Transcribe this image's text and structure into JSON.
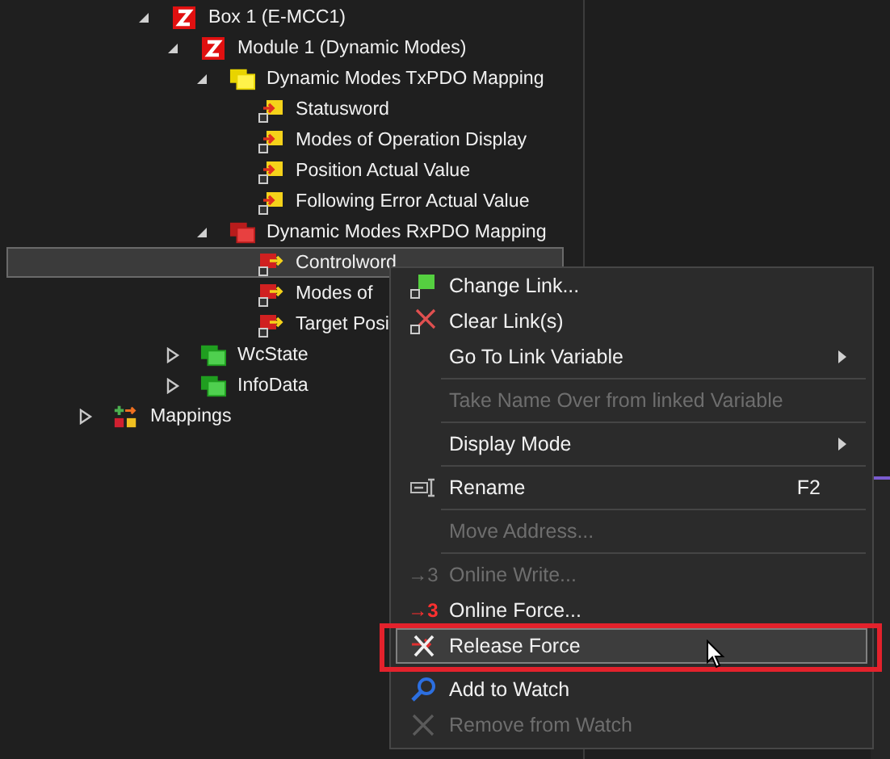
{
  "tree": [
    {
      "label": "Box 1 (E-MCC1)",
      "kind": "device",
      "expanded": true,
      "selected": false,
      "children": [
        {
          "label": "Module 1 (Dynamic Modes)",
          "kind": "device",
          "expanded": true,
          "selected": false,
          "children": [
            {
              "label": "Dynamic Modes TxPDO Mapping",
              "kind": "input_group",
              "expanded": true,
              "selected": false,
              "children": [
                {
                  "label": "Statusword",
                  "kind": "input_var",
                  "selected": false
                },
                {
                  "label": "Modes of Operation Display",
                  "kind": "input_var",
                  "selected": false
                },
                {
                  "label": "Position Actual Value",
                  "kind": "input_var",
                  "selected": false
                },
                {
                  "label": "Following Error Actual Value",
                  "kind": "input_var",
                  "selected": false
                }
              ]
            },
            {
              "label": "Dynamic Modes RxPDO Mapping",
              "kind": "output_group",
              "expanded": true,
              "selected": false,
              "children": [
                {
                  "label": "Controlword",
                  "kind": "output_var",
                  "selected": true
                },
                {
                  "label": "Modes of",
                  "kind": "output_var",
                  "selected": false
                },
                {
                  "label": "Target Posi",
                  "kind": "output_var",
                  "selected": false
                }
              ]
            }
          ]
        },
        {
          "label": "WcState",
          "kind": "status_group",
          "expanded": false,
          "selected": false
        },
        {
          "label": "InfoData",
          "kind": "status_group",
          "expanded": false,
          "selected": false
        }
      ]
    },
    {
      "label": "Mappings",
      "kind": "mappings",
      "expanded": false,
      "selected": false
    }
  ],
  "context_menu": [
    {
      "kind": "item",
      "label": "Change Link...",
      "disabled": false,
      "submenu": false,
      "selected": false
    },
    {
      "kind": "item",
      "label": "Clear Link(s)",
      "disabled": false,
      "submenu": false,
      "selected": false
    },
    {
      "kind": "item",
      "label": "Go To Link Variable",
      "disabled": false,
      "submenu": true,
      "selected": false
    },
    {
      "kind": "separator"
    },
    {
      "kind": "item",
      "label": "Take Name Over from linked Variable",
      "disabled": true,
      "submenu": false,
      "selected": false
    },
    {
      "kind": "separator"
    },
    {
      "kind": "item",
      "label": "Display Mode",
      "disabled": false,
      "submenu": true,
      "selected": false
    },
    {
      "kind": "separator"
    },
    {
      "kind": "item",
      "label": "Rename",
      "shortcut": "F2",
      "disabled": false,
      "submenu": false,
      "selected": false
    },
    {
      "kind": "separator"
    },
    {
      "kind": "item",
      "label": "Move Address...",
      "disabled": true,
      "submenu": false,
      "selected": false
    },
    {
      "kind": "separator"
    },
    {
      "kind": "item",
      "label": "Online Write...",
      "icon_text": "→3",
      "disabled": true,
      "submenu": false,
      "selected": false
    },
    {
      "kind": "item",
      "label": "Online Force...",
      "icon_text": "→3",
      "disabled": false,
      "submenu": false,
      "selected": false
    },
    {
      "kind": "item",
      "label": "Release Force",
      "disabled": false,
      "submenu": false,
      "selected": true
    },
    {
      "kind": "separator"
    },
    {
      "kind": "item",
      "label": "Add to Watch",
      "disabled": false,
      "submenu": false,
      "selected": false
    },
    {
      "kind": "item",
      "label": "Remove from Watch",
      "disabled": true,
      "submenu": false,
      "selected": false
    }
  ]
}
